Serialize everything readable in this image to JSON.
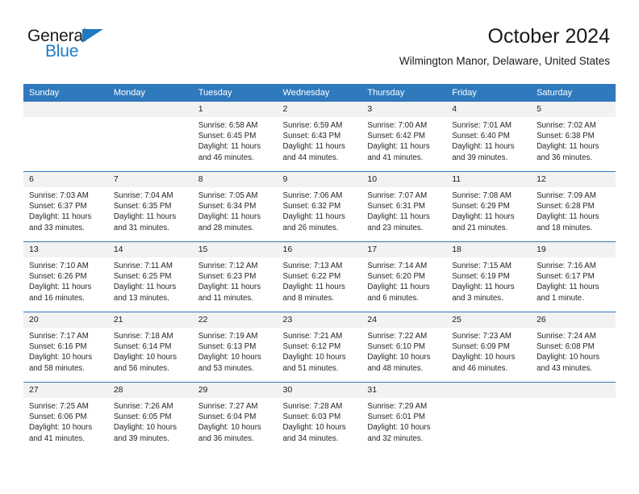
{
  "brand": {
    "name_top": "General",
    "name_bottom": "Blue",
    "accent_color": "#1f7ac2",
    "triangle_icon": "triangle-icon"
  },
  "header": {
    "month_title": "October 2024",
    "location": "Wilmington Manor, Delaware, United States"
  },
  "calendar": {
    "header_color": "#2f79bd",
    "daynum_band_color": "#f2f2f2",
    "weekday_headers": [
      "Sunday",
      "Monday",
      "Tuesday",
      "Wednesday",
      "Thursday",
      "Friday",
      "Saturday"
    ],
    "weeks": [
      [
        {
          "day": "",
          "lines": []
        },
        {
          "day": "",
          "lines": []
        },
        {
          "day": "1",
          "lines": [
            "Sunrise: 6:58 AM",
            "Sunset: 6:45 PM",
            "Daylight: 11 hours",
            "and 46 minutes."
          ]
        },
        {
          "day": "2",
          "lines": [
            "Sunrise: 6:59 AM",
            "Sunset: 6:43 PM",
            "Daylight: 11 hours",
            "and 44 minutes."
          ]
        },
        {
          "day": "3",
          "lines": [
            "Sunrise: 7:00 AM",
            "Sunset: 6:42 PM",
            "Daylight: 11 hours",
            "and 41 minutes."
          ]
        },
        {
          "day": "4",
          "lines": [
            "Sunrise: 7:01 AM",
            "Sunset: 6:40 PM",
            "Daylight: 11 hours",
            "and 39 minutes."
          ]
        },
        {
          "day": "5",
          "lines": [
            "Sunrise: 7:02 AM",
            "Sunset: 6:38 PM",
            "Daylight: 11 hours",
            "and 36 minutes."
          ]
        }
      ],
      [
        {
          "day": "6",
          "lines": [
            "Sunrise: 7:03 AM",
            "Sunset: 6:37 PM",
            "Daylight: 11 hours",
            "and 33 minutes."
          ]
        },
        {
          "day": "7",
          "lines": [
            "Sunrise: 7:04 AM",
            "Sunset: 6:35 PM",
            "Daylight: 11 hours",
            "and 31 minutes."
          ]
        },
        {
          "day": "8",
          "lines": [
            "Sunrise: 7:05 AM",
            "Sunset: 6:34 PM",
            "Daylight: 11 hours",
            "and 28 minutes."
          ]
        },
        {
          "day": "9",
          "lines": [
            "Sunrise: 7:06 AM",
            "Sunset: 6:32 PM",
            "Daylight: 11 hours",
            "and 26 minutes."
          ]
        },
        {
          "day": "10",
          "lines": [
            "Sunrise: 7:07 AM",
            "Sunset: 6:31 PM",
            "Daylight: 11 hours",
            "and 23 minutes."
          ]
        },
        {
          "day": "11",
          "lines": [
            "Sunrise: 7:08 AM",
            "Sunset: 6:29 PM",
            "Daylight: 11 hours",
            "and 21 minutes."
          ]
        },
        {
          "day": "12",
          "lines": [
            "Sunrise: 7:09 AM",
            "Sunset: 6:28 PM",
            "Daylight: 11 hours",
            "and 18 minutes."
          ]
        }
      ],
      [
        {
          "day": "13",
          "lines": [
            "Sunrise: 7:10 AM",
            "Sunset: 6:26 PM",
            "Daylight: 11 hours",
            "and 16 minutes."
          ]
        },
        {
          "day": "14",
          "lines": [
            "Sunrise: 7:11 AM",
            "Sunset: 6:25 PM",
            "Daylight: 11 hours",
            "and 13 minutes."
          ]
        },
        {
          "day": "15",
          "lines": [
            "Sunrise: 7:12 AM",
            "Sunset: 6:23 PM",
            "Daylight: 11 hours",
            "and 11 minutes."
          ]
        },
        {
          "day": "16",
          "lines": [
            "Sunrise: 7:13 AM",
            "Sunset: 6:22 PM",
            "Daylight: 11 hours",
            "and 8 minutes."
          ]
        },
        {
          "day": "17",
          "lines": [
            "Sunrise: 7:14 AM",
            "Sunset: 6:20 PM",
            "Daylight: 11 hours",
            "and 6 minutes."
          ]
        },
        {
          "day": "18",
          "lines": [
            "Sunrise: 7:15 AM",
            "Sunset: 6:19 PM",
            "Daylight: 11 hours",
            "and 3 minutes."
          ]
        },
        {
          "day": "19",
          "lines": [
            "Sunrise: 7:16 AM",
            "Sunset: 6:17 PM",
            "Daylight: 11 hours",
            "and 1 minute."
          ]
        }
      ],
      [
        {
          "day": "20",
          "lines": [
            "Sunrise: 7:17 AM",
            "Sunset: 6:16 PM",
            "Daylight: 10 hours",
            "and 58 minutes."
          ]
        },
        {
          "day": "21",
          "lines": [
            "Sunrise: 7:18 AM",
            "Sunset: 6:14 PM",
            "Daylight: 10 hours",
            "and 56 minutes."
          ]
        },
        {
          "day": "22",
          "lines": [
            "Sunrise: 7:19 AM",
            "Sunset: 6:13 PM",
            "Daylight: 10 hours",
            "and 53 minutes."
          ]
        },
        {
          "day": "23",
          "lines": [
            "Sunrise: 7:21 AM",
            "Sunset: 6:12 PM",
            "Daylight: 10 hours",
            "and 51 minutes."
          ]
        },
        {
          "day": "24",
          "lines": [
            "Sunrise: 7:22 AM",
            "Sunset: 6:10 PM",
            "Daylight: 10 hours",
            "and 48 minutes."
          ]
        },
        {
          "day": "25",
          "lines": [
            "Sunrise: 7:23 AM",
            "Sunset: 6:09 PM",
            "Daylight: 10 hours",
            "and 46 minutes."
          ]
        },
        {
          "day": "26",
          "lines": [
            "Sunrise: 7:24 AM",
            "Sunset: 6:08 PM",
            "Daylight: 10 hours",
            "and 43 minutes."
          ]
        }
      ],
      [
        {
          "day": "27",
          "lines": [
            "Sunrise: 7:25 AM",
            "Sunset: 6:06 PM",
            "Daylight: 10 hours",
            "and 41 minutes."
          ]
        },
        {
          "day": "28",
          "lines": [
            "Sunrise: 7:26 AM",
            "Sunset: 6:05 PM",
            "Daylight: 10 hours",
            "and 39 minutes."
          ]
        },
        {
          "day": "29",
          "lines": [
            "Sunrise: 7:27 AM",
            "Sunset: 6:04 PM",
            "Daylight: 10 hours",
            "and 36 minutes."
          ]
        },
        {
          "day": "30",
          "lines": [
            "Sunrise: 7:28 AM",
            "Sunset: 6:03 PM",
            "Daylight: 10 hours",
            "and 34 minutes."
          ]
        },
        {
          "day": "31",
          "lines": [
            "Sunrise: 7:29 AM",
            "Sunset: 6:01 PM",
            "Daylight: 10 hours",
            "and 32 minutes."
          ]
        },
        {
          "day": "",
          "lines": []
        },
        {
          "day": "",
          "lines": []
        }
      ]
    ]
  }
}
